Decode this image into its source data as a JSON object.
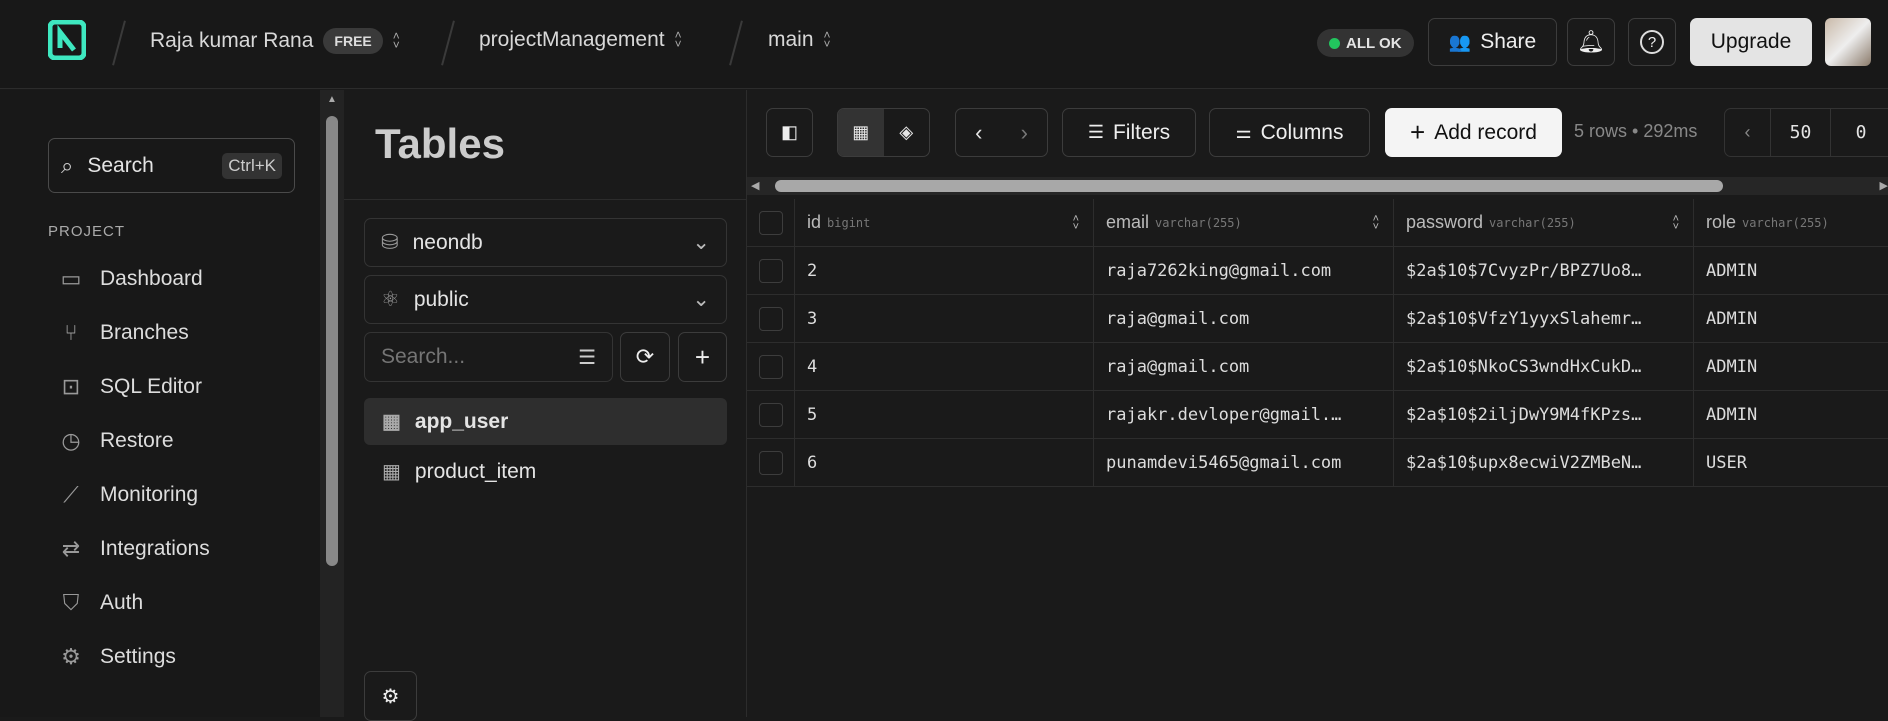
{
  "header": {
    "org": "Raja kumar Rana",
    "plan": "FREE",
    "project": "projectManagement",
    "branch": "main",
    "status": "ALL OK",
    "status_color": "#22c55e",
    "share": "Share",
    "upgrade": "Upgrade"
  },
  "sidebar": {
    "search": "Search",
    "shortcut": "Ctrl+K",
    "section": "PROJECT",
    "items": [
      {
        "label": "Dashboard",
        "icon": "dashboard-icon"
      },
      {
        "label": "Branches",
        "icon": "branch-icon"
      },
      {
        "label": "SQL Editor",
        "icon": "terminal-icon"
      },
      {
        "label": "Restore",
        "icon": "restore-icon"
      },
      {
        "label": "Monitoring",
        "icon": "chart-icon"
      },
      {
        "label": "Integrations",
        "icon": "integrations-icon"
      },
      {
        "label": "Auth",
        "icon": "shield-icon"
      },
      {
        "label": "Settings",
        "icon": "gear-icon"
      }
    ]
  },
  "tables": {
    "title": "Tables",
    "database": "neondb",
    "schema": "public",
    "search_placeholder": "Search...",
    "items": [
      "app_user",
      "product_item"
    ],
    "selected": "app_user"
  },
  "toolbar": {
    "filters": "Filters",
    "columns": "Columns",
    "add_record": "Add record",
    "info": "5 rows • 292ms",
    "limit": "50",
    "offset": "0"
  },
  "grid": {
    "columns": [
      {
        "name": "id",
        "type": "bigint"
      },
      {
        "name": "email",
        "type": "varchar(255)"
      },
      {
        "name": "password",
        "type": "varchar(255)"
      },
      {
        "name": "role",
        "type": "varchar(255)"
      }
    ],
    "rows": [
      [
        "2",
        "raja7262king@gmail.com",
        "$2a$10$7CvyzPr/BPZ7Uo8…",
        "ADMIN"
      ],
      [
        "3",
        "raja@gmail.com",
        "$2a$10$VfzY1yyxSlahemr…",
        "ADMIN"
      ],
      [
        "4",
        "raja@gmail.com",
        "$2a$10$NkoCS3wndHxCukD…",
        "ADMIN"
      ],
      [
        "5",
        "rajakr.devloper@gmail.…",
        "$2a$10$2iljDwY9M4fKPzs…",
        "ADMIN"
      ],
      [
        "6",
        "punamdevi5465@gmail.com",
        "$2a$10$upx8ecwiV2ZMBeN…",
        "USER"
      ]
    ]
  }
}
